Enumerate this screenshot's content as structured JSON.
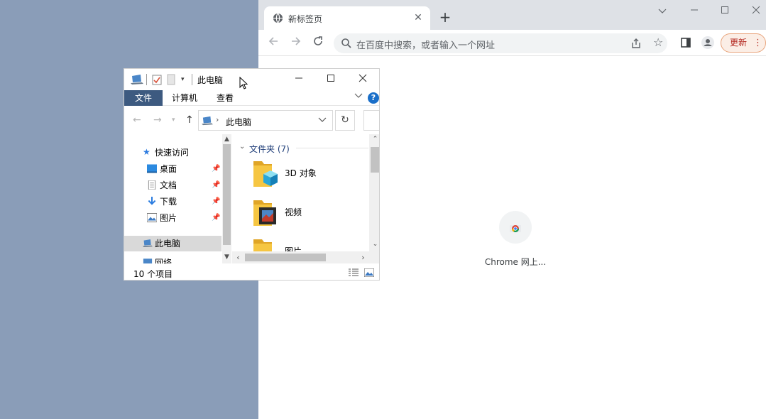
{
  "chrome": {
    "tab_title": "新标签页",
    "omnibox_placeholder": "在百度中搜索，或者输入一个网址",
    "update_label": "更新",
    "update_menu": "⋮",
    "shortcut_label": "Chrome 网上...",
    "colors": {
      "tabbar": "#dee1e6",
      "update_border": "#e8a37a",
      "update_text": "#b3261e"
    }
  },
  "explorer": {
    "window_title": "此电脑",
    "ribbon_tabs": [
      "文件",
      "计算机",
      "查看"
    ],
    "help_label": "?",
    "address_crumb": "此电脑",
    "nav_items": [
      {
        "label": "快速访问",
        "icon": "star-icon"
      },
      {
        "label": "桌面",
        "icon": "desktop-icon",
        "pinned": true
      },
      {
        "label": "文档",
        "icon": "document-icon",
        "pinned": true
      },
      {
        "label": "下载",
        "icon": "download-icon",
        "pinned": true
      },
      {
        "label": "图片",
        "icon": "picture-icon",
        "pinned": true
      },
      {
        "label": "此电脑",
        "icon": "computer-icon",
        "selected": true
      },
      {
        "label": "网络",
        "icon": "network-icon"
      }
    ],
    "group_header": "文件夹 (7)",
    "folders": [
      "3D 对象",
      "视频",
      "图片"
    ],
    "status_count": "10 个项目",
    "colors": {
      "file_tab": "#3d5a80",
      "group_text": "#1e3d78",
      "help": "#1a6fc9"
    }
  }
}
